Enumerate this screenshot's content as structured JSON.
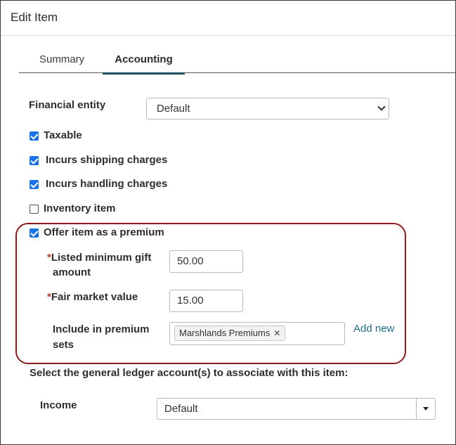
{
  "dialog": {
    "title": "Edit Item"
  },
  "tabs": [
    {
      "label": "Summary",
      "active": false
    },
    {
      "label": "Accounting",
      "active": true
    }
  ],
  "financial_entity": {
    "label": "Financial entity",
    "value": "Default"
  },
  "checkboxes": [
    {
      "label": "Taxable",
      "checked": true
    },
    {
      "label": "Incurs shipping charges",
      "checked": true
    },
    {
      "label": "Incurs handling charges",
      "checked": true
    },
    {
      "label": "Inventory item",
      "checked": false
    },
    {
      "label": "Offer item as a premium",
      "checked": true
    }
  ],
  "premium": {
    "required_mark": "*",
    "min_gift": {
      "label_line1": "Listed minimum gift",
      "label_line2": "amount",
      "value": "50.00"
    },
    "fair_market": {
      "label": "Fair market value",
      "value": "15.00"
    },
    "sets": {
      "label_line1": "Include in premium",
      "label_line2": "sets",
      "tags": [
        "Marshlands Premiums"
      ],
      "remove_glyph": "✕",
      "add_new": "Add new"
    }
  },
  "gl": {
    "prompt": "Select the general ledger account(s) to associate with this item:",
    "income": {
      "label": "Income",
      "value": "Default"
    }
  },
  "colors": {
    "accent": "#1a73e8",
    "tab_underline": "#1f4e63",
    "highlight_border": "#8b1a1a",
    "link": "#1f6f8b"
  }
}
